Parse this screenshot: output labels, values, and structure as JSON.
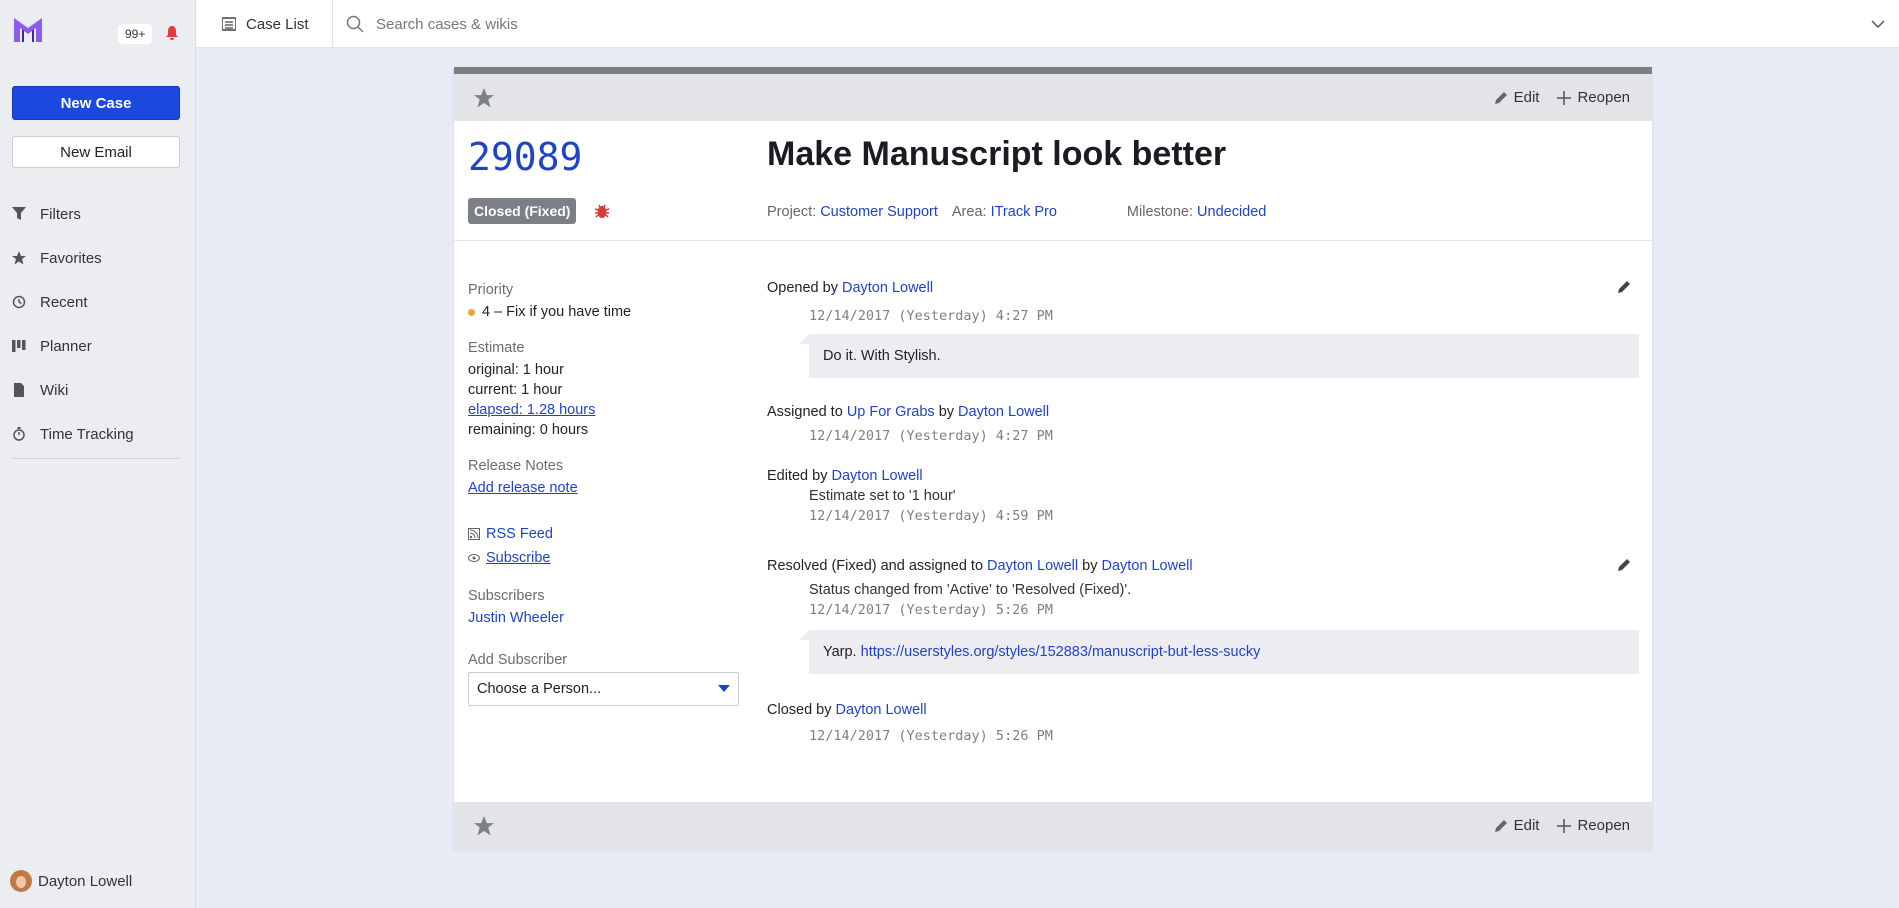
{
  "sidebar": {
    "notifications_count": "99+",
    "new_case_label": "New Case",
    "new_email_label": "New Email",
    "nav": [
      "Filters",
      "Favorites",
      "Recent",
      "Planner",
      "Wiki",
      "Time Tracking"
    ],
    "user_name": "Dayton Lowell"
  },
  "topbar": {
    "case_list_label": "Case List",
    "search_placeholder": "Search cases & wikis"
  },
  "toolbar": {
    "edit_label": "Edit",
    "reopen_label": "Reopen"
  },
  "case": {
    "number": "29089",
    "status": "Closed (Fixed)",
    "title": "Make Manuscript look better",
    "project_label": "Project:",
    "project": "Customer Support",
    "area_label": "Area:",
    "area": "ITrack Pro",
    "milestone_label": "Milestone:",
    "milestone": "Undecided"
  },
  "details": {
    "priority_label": "Priority",
    "priority": "4 – Fix if you have time",
    "estimate_label": "Estimate",
    "estimate_original": "original: 1 hour",
    "estimate_current": "current: 1 hour",
    "estimate_elapsed": "elapsed: 1.28 hours",
    "estimate_remaining": "remaining: 0 hours",
    "release_notes_label": "Release Notes",
    "add_release_note": "Add release note",
    "rss_feed": "RSS Feed",
    "subscribe": "Subscribe",
    "subscribers_label": "Subscribers",
    "subscriber": "Justin Wheeler",
    "add_subscriber_label": "Add Subscriber",
    "choose_person": "Choose a Person..."
  },
  "events": [
    {
      "prefix": "Opened by",
      "actor": "Dayton Lowell",
      "timestamp": "12/14/2017 (Yesterday) 4:27 PM",
      "body": "Do it. With Stylish."
    },
    {
      "prefix": "Assigned to",
      "target": "Up For Grabs",
      "mid": "by",
      "actor": "Dayton Lowell",
      "timestamp": "12/14/2017 (Yesterday) 4:27 PM"
    },
    {
      "prefix": "Edited by",
      "actor": "Dayton Lowell",
      "text": "Estimate set to '1 hour'",
      "timestamp": "12/14/2017 (Yesterday) 4:59 PM"
    },
    {
      "prefix": "Resolved (Fixed) and assigned to",
      "target": "Dayton Lowell",
      "mid": "by",
      "actor": "Dayton Lowell",
      "text": "Status changed from 'Active' to 'Resolved (Fixed)'.",
      "timestamp": "12/14/2017 (Yesterday) 5:26 PM",
      "body_prefix": "Yarp.",
      "body_link": "https://userstyles.org/styles/152883/manuscript-but-less-sucky"
    },
    {
      "prefix": "Closed by",
      "actor": "Dayton Lowell",
      "timestamp": "12/14/2017 (Yesterday) 5:26 PM"
    }
  ],
  "colors": {
    "accent": "#1c48e0",
    "link": "#1f43c8",
    "status_badge": "#7d7f86",
    "priority_dot": "#e9a645",
    "bug_icon": "#d93a3a"
  }
}
